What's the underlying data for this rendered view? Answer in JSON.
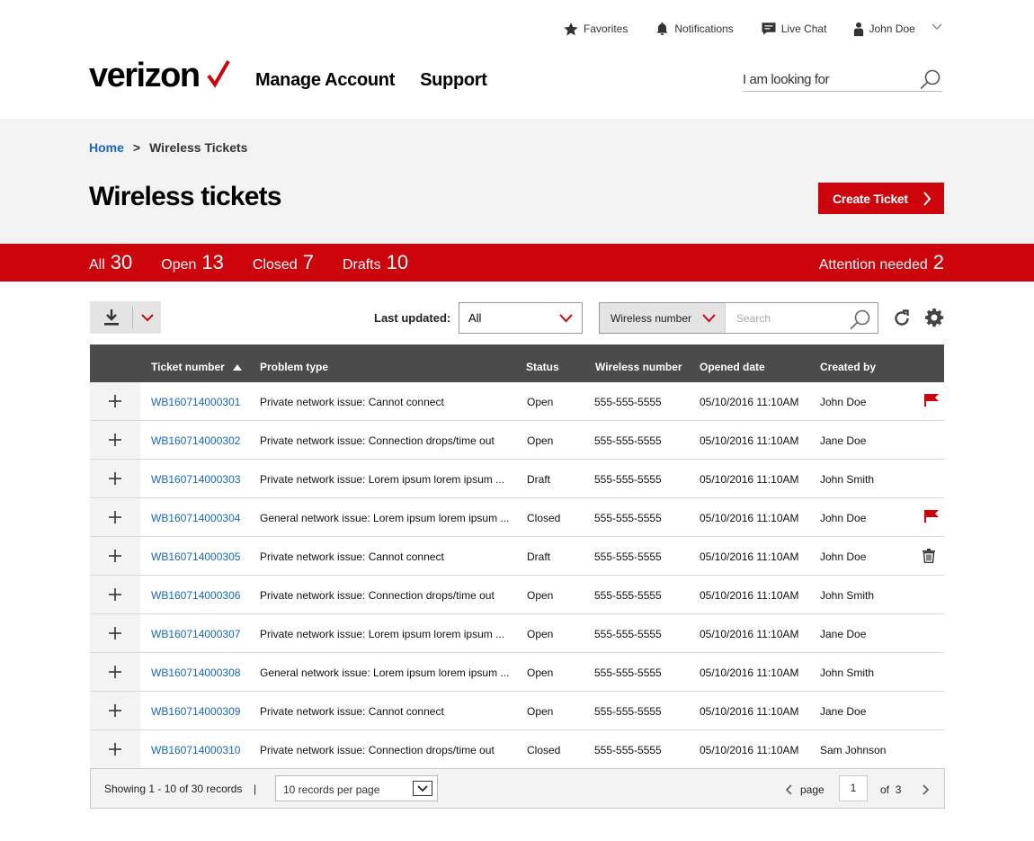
{
  "utility": {
    "favorites": "Favorites",
    "notifications": "Notifications",
    "live_chat": "Live Chat",
    "user": "John Doe"
  },
  "header": {
    "logo": "verizon",
    "nav": [
      "Manage Account",
      "Support"
    ],
    "search_placeholder": "I am looking for"
  },
  "breadcrumb": {
    "home": "Home",
    "separator": ">",
    "current": "Wireless Tickets"
  },
  "page_title": "Wireless tickets",
  "create_button": "Create Ticket",
  "filters": {
    "tabs": [
      {
        "label": "All",
        "count": "30"
      },
      {
        "label": "Open",
        "count": "13"
      },
      {
        "label": "Closed",
        "count": "7"
      },
      {
        "label": "Drafts",
        "count": "10"
      }
    ],
    "attention": {
      "label": "Attention needed",
      "count": "2"
    }
  },
  "toolbar": {
    "last_updated_label": "Last updated:",
    "last_updated_value": "All",
    "search_by": "Wireless number",
    "search_placeholder": "Search"
  },
  "table": {
    "columns": [
      "Ticket number",
      "Problem type",
      "Status",
      "Wireless number",
      "Opened date",
      "Created by"
    ],
    "rows": [
      {
        "ticket": "WB160714000301",
        "problem": "Private network issue: Cannot connect",
        "status": "Open",
        "number": "555-555-5555",
        "opened": "05/10/2016 11:10AM",
        "created_by": "John Doe",
        "action": "flag-icon"
      },
      {
        "ticket": "WB160714000302",
        "problem": "Private network issue: Connection drops/time out",
        "status": "Open",
        "number": "555-555-5555",
        "opened": "05/10/2016 11:10AM",
        "created_by": "Jane Doe",
        "action": ""
      },
      {
        "ticket": "WB160714000303",
        "problem": "Private network issue: Lorem ipsum lorem ipsum ...",
        "status": "Draft",
        "number": "555-555-5555",
        "opened": "05/10/2016 11:10AM",
        "created_by": "John Smith",
        "action": ""
      },
      {
        "ticket": "WB160714000304",
        "problem": "General network issue: Lorem ipsum lorem ipsum ...",
        "status": "Closed",
        "number": "555-555-5555",
        "opened": "05/10/2016 11:10AM",
        "created_by": "John Doe",
        "action": "flag-icon"
      },
      {
        "ticket": "WB160714000305",
        "problem": "Private network issue: Cannot connect",
        "status": "Draft",
        "number": "555-555-5555",
        "opened": "05/10/2016 11:10AM",
        "created_by": "John Doe",
        "action": "trash-icon"
      },
      {
        "ticket": "WB160714000306",
        "problem": "Private network issue: Connection drops/time out",
        "status": "Open",
        "number": "555-555-5555",
        "opened": "05/10/2016 11:10AM",
        "created_by": "John Smith",
        "action": ""
      },
      {
        "ticket": "WB160714000307",
        "problem": "Private network issue: Lorem ipsum lorem ipsum ...",
        "status": "Open",
        "number": "555-555-5555",
        "opened": "05/10/2016 11:10AM",
        "created_by": "Jane Doe",
        "action": ""
      },
      {
        "ticket": "WB160714000308",
        "problem": "General network issue: Lorem ipsum lorem ipsum ...",
        "status": "Open",
        "number": "555-555-5555",
        "opened": "05/10/2016 11:10AM",
        "created_by": "John Smith",
        "action": ""
      },
      {
        "ticket": "WB160714000309",
        "problem": "Private network issue: Cannot connect",
        "status": "Open",
        "number": "555-555-5555",
        "opened": "05/10/2016 11:10AM",
        "created_by": "Jane Doe",
        "action": ""
      },
      {
        "ticket": "WB160714000310",
        "problem": "Private network issue: Connection drops/time out",
        "status": "Closed",
        "number": "555-555-5555",
        "opened": "05/10/2016 11:10AM",
        "created_by": "Sam Johnson",
        "action": ""
      }
    ]
  },
  "footer": {
    "showing": "Showing 1 - 10 of 30 records",
    "pipe": "|",
    "per_page": "10 records per page",
    "page_label": "page",
    "page_value": "1",
    "of_label": "of",
    "total_pages": "3"
  },
  "colors": {
    "brand_red": "#cd040b",
    "link_blue": "#1666c5",
    "header_dark": "#4b4b4b",
    "band_grey": "#f3f3f3"
  }
}
